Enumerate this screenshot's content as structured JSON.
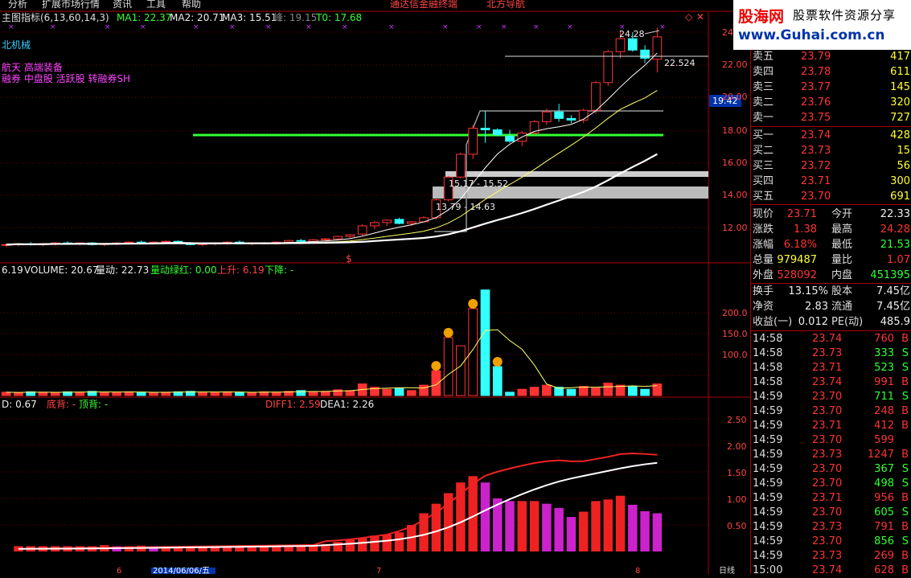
{
  "menu": [
    "分析",
    "扩展市场行情",
    "资讯",
    "工具",
    "帮助"
  ],
  "app_title": "通达信金融终端",
  "app_subtitle": "北方导航",
  "logo": {
    "name": "股海网",
    "tagline": "股票软件资源分享",
    "url": "www.Guhai.com.cn"
  },
  "main_header": {
    "label": "主图指标(6,13,60,14,3)",
    "ma1": "MA1: 22.37",
    "ma2": "MA2: 20.71",
    "ma3": "MA3: 15.51",
    "peak": "峰: 19.15",
    "t0": "T0: 17.68"
  },
  "stock_notes": [
    "北机械",
    "航天 高端装备",
    "融券 中盘股 活跃股 转融券SH"
  ],
  "annotations": {
    "high": "24.28",
    "ref": "22.524",
    "box1": "15.17 - 15.52",
    "box2": "13.79 - 14.63",
    "dollar": "$",
    "crosshair_price": "19.42"
  },
  "price_axis": [
    "24",
    "22.00",
    "20.00",
    "18.00",
    "16.00",
    "14.00",
    "12.00"
  ],
  "volume_header": {
    "ma": "6.19",
    "volume": "VOLUME: 20.67",
    "liangdong": "量动: 22.73",
    "lvhong": "量动绿红: 0.00",
    "up": "上升: 6.19",
    "down": "下降: -"
  },
  "volume_axis": [
    "200.0",
    "150.0",
    "100.0"
  ],
  "macd_header": {
    "d": "D: 0.67",
    "dibei": "底背: -",
    "dingbei": "顶背: -",
    "diff": "DIFF1: 2.59",
    "dea": "DEA1: 2.26"
  },
  "macd_axis": [
    "2.50",
    "2.00",
    "1.50",
    "1.00",
    "0.50"
  ],
  "date_axis": [
    "6",
    "2014/06/06/五",
    "7",
    "8",
    "日线"
  ],
  "order_book": {
    "top_labels": [
      "卖五",
      "卖四",
      "卖三",
      "卖二",
      "卖一"
    ],
    "asks": [
      {
        "label": "卖五",
        "price": "23.79",
        "vol": "417"
      },
      {
        "label": "卖四",
        "price": "23.78",
        "vol": "611"
      },
      {
        "label": "卖三",
        "price": "23.77",
        "vol": "145"
      },
      {
        "label": "卖二",
        "price": "23.76",
        "vol": "320"
      },
      {
        "label": "卖一",
        "price": "23.75",
        "vol": "727"
      }
    ],
    "bids": [
      {
        "label": "买一",
        "price": "23.74",
        "vol": "428"
      },
      {
        "label": "买二",
        "price": "23.73",
        "vol": "15"
      },
      {
        "label": "买三",
        "price": "23.72",
        "vol": "56"
      },
      {
        "label": "买四",
        "price": "23.71",
        "vol": "300"
      },
      {
        "label": "买五",
        "price": "23.70",
        "vol": "691"
      }
    ]
  },
  "quote": [
    {
      "l1": "现价",
      "v1": "23.71",
      "c1": "red",
      "l2": "今开",
      "v2": "22.33",
      "c2": "wht"
    },
    {
      "l1": "涨跌",
      "v1": "1.38",
      "c1": "red",
      "l2": "最高",
      "v2": "24.28",
      "c2": "red"
    },
    {
      "l1": "涨幅",
      "v1": "6.18%",
      "c1": "red",
      "l2": "最低",
      "v2": "21.53",
      "c2": "grn"
    },
    {
      "l1": "总量",
      "v1": "979487",
      "c1": "yel",
      "l2": "量比",
      "v2": "1.07",
      "c2": "red"
    },
    {
      "l1": "外盘",
      "v1": "528092",
      "c1": "red",
      "l2": "内盘",
      "v2": "451395",
      "c2": "grn"
    }
  ],
  "fundamentals": [
    {
      "l1": "换手",
      "v1": "13.15%",
      "l2": "股本",
      "v2": "7.45亿"
    },
    {
      "l1": "净资",
      "v1": "2.83",
      "l2": "流通",
      "v2": "7.45亿"
    },
    {
      "l1": "收益(一)",
      "v1": "0.012",
      "l2": "PE(动)",
      "v2": "485.9"
    }
  ],
  "ticks": [
    {
      "time": "14:58",
      "price": "23.74",
      "vol": "760",
      "side": "B"
    },
    {
      "time": "14:58",
      "price": "23.73",
      "vol": "333",
      "side": "S"
    },
    {
      "time": "14:58",
      "price": "23.71",
      "vol": "523",
      "side": "S"
    },
    {
      "time": "14:58",
      "price": "23.74",
      "vol": "991",
      "side": "B"
    },
    {
      "time": "14:59",
      "price": "23.70",
      "vol": "711",
      "side": "S"
    },
    {
      "time": "14:59",
      "price": "23.70",
      "vol": "248",
      "side": "B"
    },
    {
      "time": "14:59",
      "price": "23.71",
      "vol": "412",
      "side": "B"
    },
    {
      "time": "14:59",
      "price": "23.70",
      "vol": "599",
      "side": ""
    },
    {
      "time": "14:59",
      "price": "23.73",
      "vol": "1247",
      "side": "B"
    },
    {
      "time": "14:59",
      "price": "23.70",
      "vol": "367",
      "side": "S"
    },
    {
      "time": "14:59",
      "price": "23.70",
      "vol": "498",
      "side": "S"
    },
    {
      "time": "14:59",
      "price": "23.71",
      "vol": "956",
      "side": "B"
    },
    {
      "time": "14:59",
      "price": "23.70",
      "vol": "605",
      "side": "S"
    },
    {
      "time": "14:59",
      "price": "23.73",
      "vol": "791",
      "side": "B"
    },
    {
      "time": "14:59",
      "price": "23.70",
      "vol": "856",
      "side": "S"
    },
    {
      "time": "14:59",
      "price": "23.73",
      "vol": "269",
      "side": "B"
    },
    {
      "time": "15:00",
      "price": "23.74",
      "vol": "628",
      "side": "B"
    }
  ],
  "chart_data": {
    "type": "candlestick",
    "candles": [
      [
        10.9,
        11.0,
        10.8,
        10.95
      ],
      [
        10.95,
        11.05,
        10.85,
        11.0
      ],
      [
        11.0,
        11.1,
        10.9,
        10.95
      ],
      [
        10.95,
        11.05,
        10.85,
        11.0
      ],
      [
        11.0,
        11.1,
        10.9,
        11.05
      ],
      [
        11.05,
        11.15,
        10.95,
        11.0
      ],
      [
        11.0,
        11.1,
        10.9,
        11.05
      ],
      [
        11.05,
        11.1,
        10.9,
        10.95
      ],
      [
        10.95,
        11.05,
        10.85,
        11.0
      ],
      [
        11.0,
        11.1,
        10.9,
        11.05
      ],
      [
        11.05,
        11.15,
        10.95,
        11.1
      ],
      [
        11.1,
        11.2,
        11.0,
        11.05
      ],
      [
        11.05,
        11.15,
        10.95,
        11.1
      ],
      [
        11.1,
        11.2,
        11.0,
        11.15
      ],
      [
        11.15,
        11.2,
        11.0,
        11.05
      ],
      [
        11.05,
        11.1,
        10.9,
        10.95
      ],
      [
        10.95,
        11.05,
        10.85,
        11.0
      ],
      [
        11.0,
        11.1,
        10.9,
        11.05
      ],
      [
        11.05,
        11.15,
        10.95,
        11.1
      ],
      [
        11.1,
        11.2,
        11.0,
        11.0
      ],
      [
        11.0,
        11.1,
        10.9,
        11.05
      ],
      [
        11.05,
        11.1,
        10.95,
        11.05
      ],
      [
        11.05,
        11.15,
        10.95,
        11.1
      ],
      [
        11.1,
        11.25,
        11.0,
        11.2
      ],
      [
        11.2,
        11.3,
        11.1,
        11.15
      ],
      [
        11.15,
        11.3,
        11.1,
        11.25
      ],
      [
        11.25,
        11.35,
        11.15,
        11.3
      ],
      [
        11.3,
        11.5,
        11.2,
        11.45
      ],
      [
        11.45,
        11.6,
        11.35,
        11.55
      ],
      [
        11.6,
        12.2,
        11.5,
        12.1
      ],
      [
        12.1,
        12.4,
        11.9,
        12.3
      ],
      [
        12.3,
        12.5,
        12.1,
        12.45
      ],
      [
        12.5,
        12.6,
        12.2,
        12.25
      ],
      [
        12.25,
        12.4,
        12.1,
        12.35
      ],
      [
        12.35,
        12.7,
        12.3,
        12.6
      ],
      [
        12.6,
        13.8,
        12.5,
        13.7
      ],
      [
        13.7,
        15.17,
        13.6,
        15.1
      ],
      [
        15.1,
        16.6,
        15.0,
        16.5
      ],
      [
        16.5,
        18.3,
        16.2,
        18.1
      ],
      [
        18.1,
        19.15,
        17.2,
        18.0
      ],
      [
        18.0,
        18.1,
        17.6,
        17.7
      ],
      [
        17.6,
        18.0,
        17.2,
        17.3
      ],
      [
        17.3,
        17.9,
        17.0,
        17.8
      ],
      [
        17.8,
        18.6,
        17.7,
        18.5
      ],
      [
        18.5,
        19.3,
        18.3,
        19.1
      ],
      [
        19.1,
        19.6,
        18.5,
        18.7
      ],
      [
        18.7,
        18.9,
        18.4,
        18.6
      ],
      [
        18.6,
        19.3,
        18.4,
        19.2
      ],
      [
        19.2,
        21.0,
        19.0,
        20.9
      ],
      [
        20.9,
        22.9,
        20.7,
        22.8
      ],
      [
        22.8,
        24.1,
        22.4,
        23.6
      ],
      [
        23.6,
        24.0,
        22.8,
        22.9
      ],
      [
        22.9,
        23.2,
        22.1,
        22.4
      ],
      [
        22.33,
        24.28,
        21.53,
        23.71
      ]
    ],
    "volume": [
      8,
      7,
      9,
      8,
      7,
      9,
      8,
      10,
      8,
      7,
      9,
      8,
      7,
      8,
      9,
      10,
      8,
      7,
      9,
      8,
      7,
      9,
      8,
      10,
      12,
      9,
      10,
      14,
      12,
      28,
      20,
      15,
      18,
      12,
      25,
      60,
      140,
      120,
      210,
      255,
      70,
      8,
      15,
      20,
      25,
      20,
      15,
      22,
      18,
      30,
      25,
      22,
      15,
      28
    ],
    "macd_hist": [
      0.1,
      0.1,
      0.1,
      0.1,
      0.1,
      0.1,
      0.1,
      0.12,
      0.1,
      0.1,
      0.11,
      0.1,
      0.1,
      0.1,
      0.1,
      0.1,
      0.1,
      0.1,
      0.1,
      0.1,
      0.1,
      0.1,
      0.1,
      0.1,
      0.12,
      0.14,
      0.18,
      0.22,
      0.26,
      0.3,
      0.32,
      0.36,
      0.5,
      0.72,
      0.9,
      1.1,
      1.3,
      1.42,
      1.3,
      1.0,
      0.95,
      0.95,
      0.95,
      0.9,
      0.82,
      0.65,
      0.75,
      0.95,
      0.98,
      1.05,
      0.88,
      0.76,
      0.72
    ],
    "price_ylim": [
      11.0,
      25.0
    ],
    "volume_ylim": [
      0,
      260
    ],
    "macd_ylim": [
      0,
      2.8
    ],
    "support_line": 17.68
  }
}
